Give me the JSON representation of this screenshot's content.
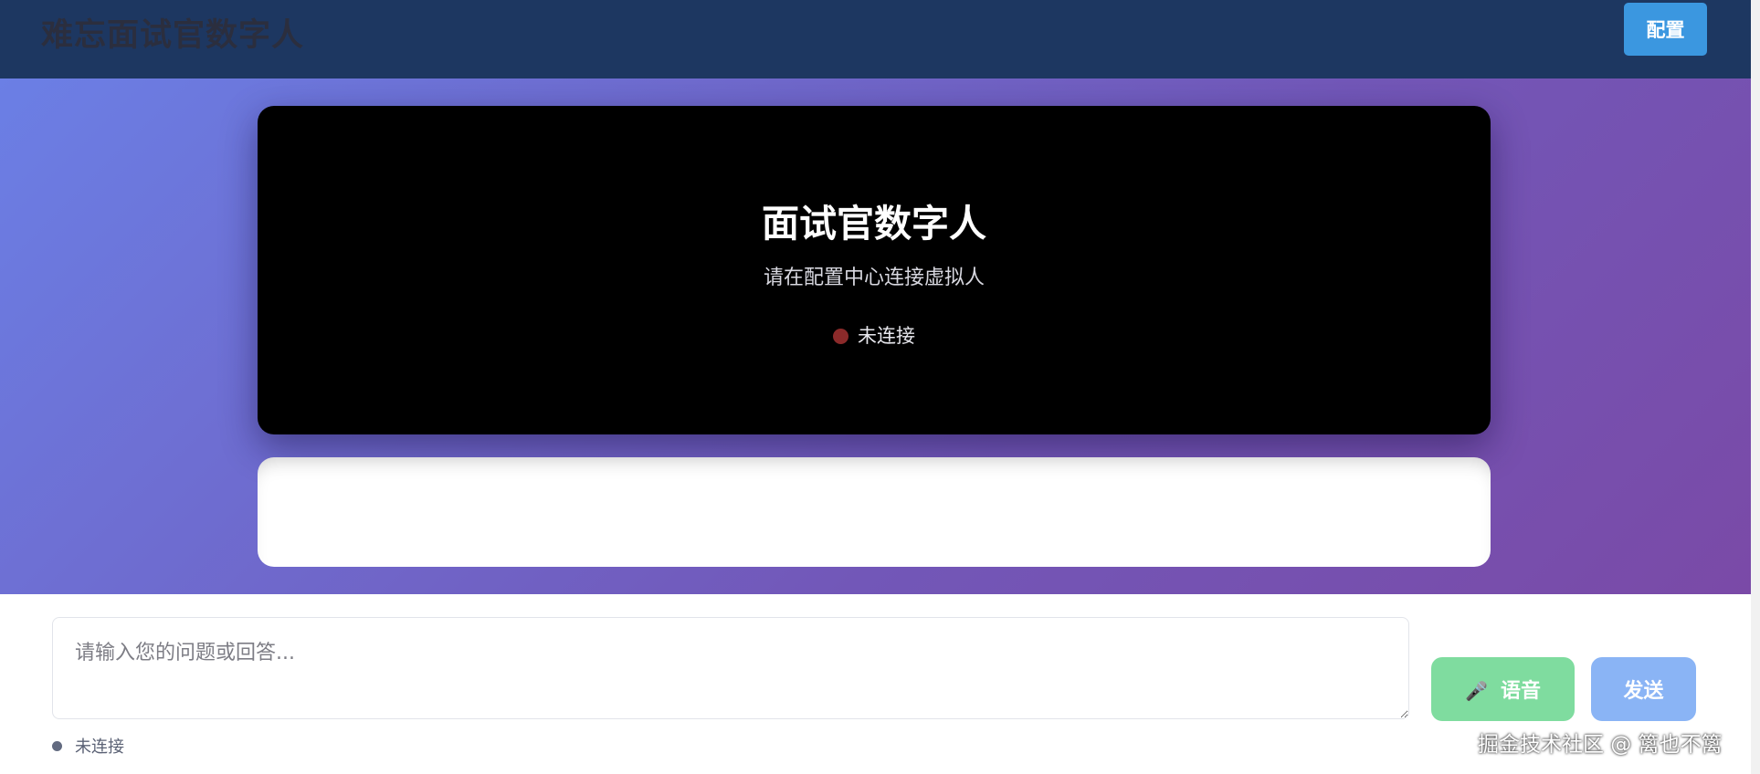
{
  "header": {
    "title": "难忘面试官数字人",
    "config_button_label": "配置"
  },
  "video_panel": {
    "avatar_title": "面试官数字人",
    "avatar_subtitle": "请在配置中心连接虚拟人",
    "status_text": "未连接"
  },
  "input_bar": {
    "placeholder": "请输入您的问题或回答...",
    "value": "",
    "voice_button_label": "语音",
    "send_button_label": "发送",
    "connection_status": "未连接"
  },
  "watermark": "掘金技术社区 @ 篱也不篱",
  "icons": {
    "voice_button": "microphone-icon",
    "avatar_status": "status-dot-icon",
    "connection_status": "status-dot-icon"
  },
  "colors": {
    "header_bg": "#1d3761",
    "config_button": "#3b97e0",
    "voice_button": "#7fdc9f",
    "send_button": "#8ab4f5",
    "status_disconnected": "#8b2a2a"
  }
}
